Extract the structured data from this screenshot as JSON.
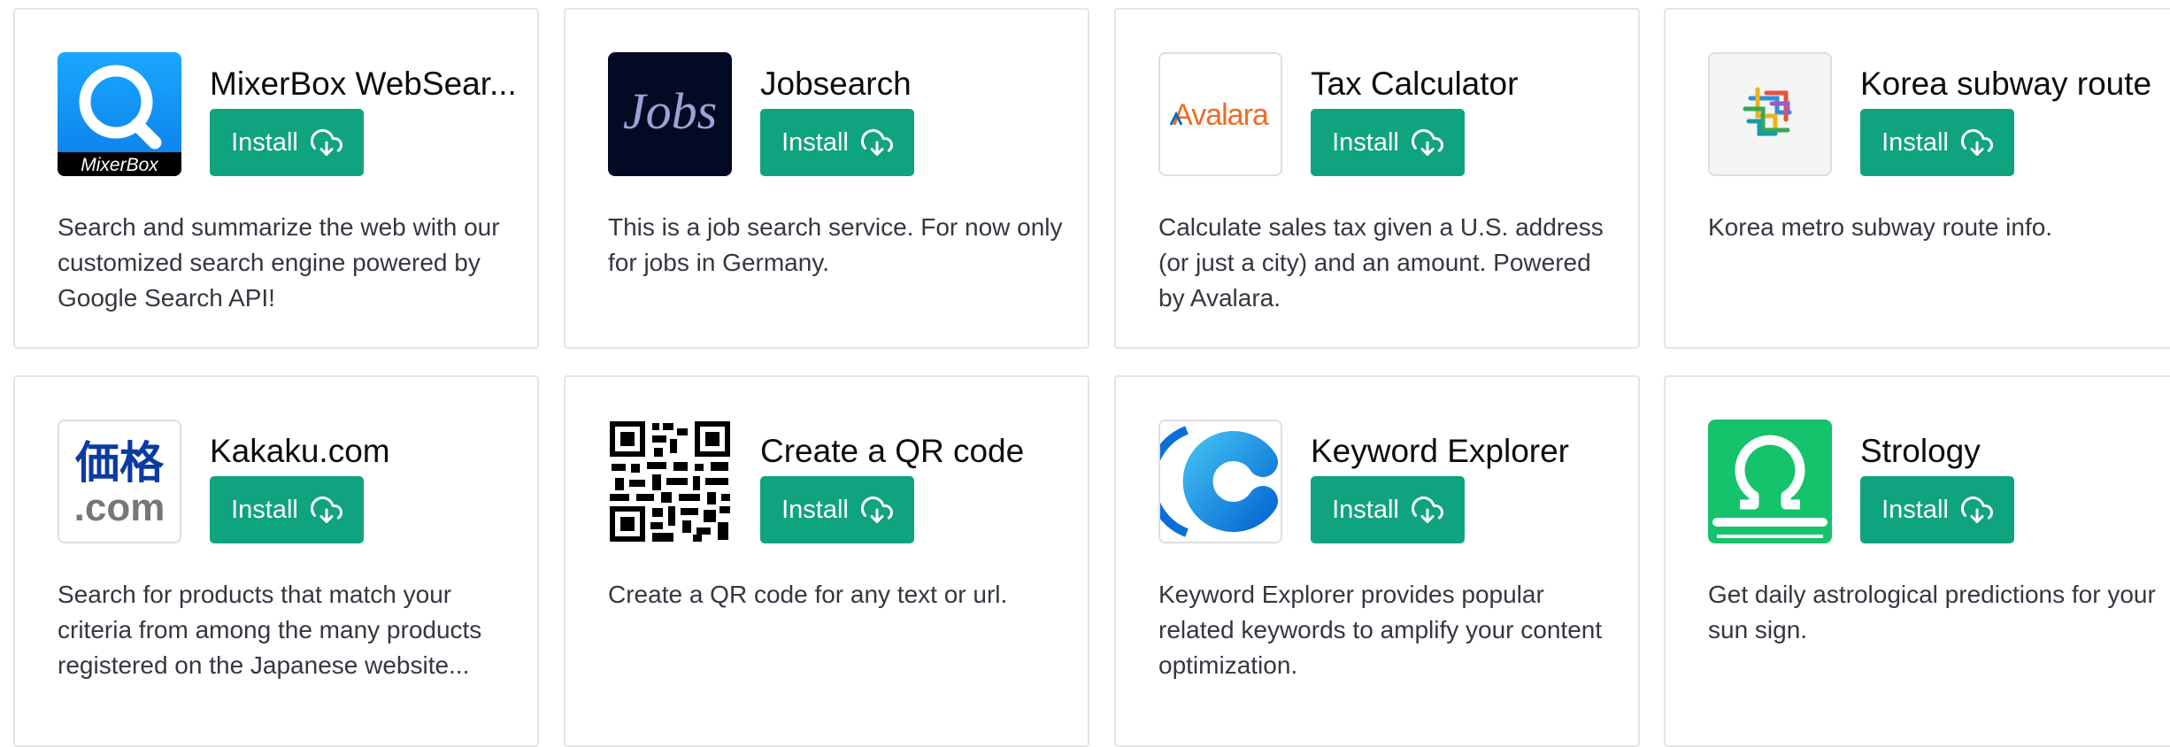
{
  "install_label": "Install",
  "plugins": [
    {
      "title": "MixerBox WebSear...",
      "logo": "mixerbox-logo",
      "logo_text": "MixerBox",
      "description": "Search and summarize the web with our customized search engine powered by Google Search API!"
    },
    {
      "title": "Jobsearch",
      "logo": "jobs-logo",
      "logo_text": "Jobs",
      "description": "This is a job search service. For now only for jobs in Germany."
    },
    {
      "title": "Tax Calculator",
      "logo": "avalara-logo",
      "logo_text": "Avalara",
      "description": "Calculate sales tax given a U.S. address (or just a city) and an amount. Powered by Avalara."
    },
    {
      "title": "Korea subway route",
      "logo": "subway-map-logo",
      "logo_text": "",
      "description": "Korea metro subway route info."
    },
    {
      "title": "Kakaku.com",
      "logo": "kakaku-logo",
      "logo_text": "価格",
      "logo_text2": ".com",
      "description": "Search for products that match your criteria from among the many products registered on the Japanese website..."
    },
    {
      "title": "Create a QR code",
      "logo": "qr-code-logo",
      "logo_text": "",
      "description": "Create a QR code for any text or url."
    },
    {
      "title": "Keyword Explorer",
      "logo": "keyword-explorer-logo",
      "logo_text": "",
      "description": "Keyword Explorer provides popular related keywords to amplify your content optimization."
    },
    {
      "title": "Strology",
      "logo": "strology-logo",
      "logo_text": "",
      "description": "Get daily astrological predictions for your sun sign."
    }
  ],
  "colors": {
    "install_button": "#10a37f",
    "border": "#e5e5e5",
    "description_text": "#353740"
  }
}
